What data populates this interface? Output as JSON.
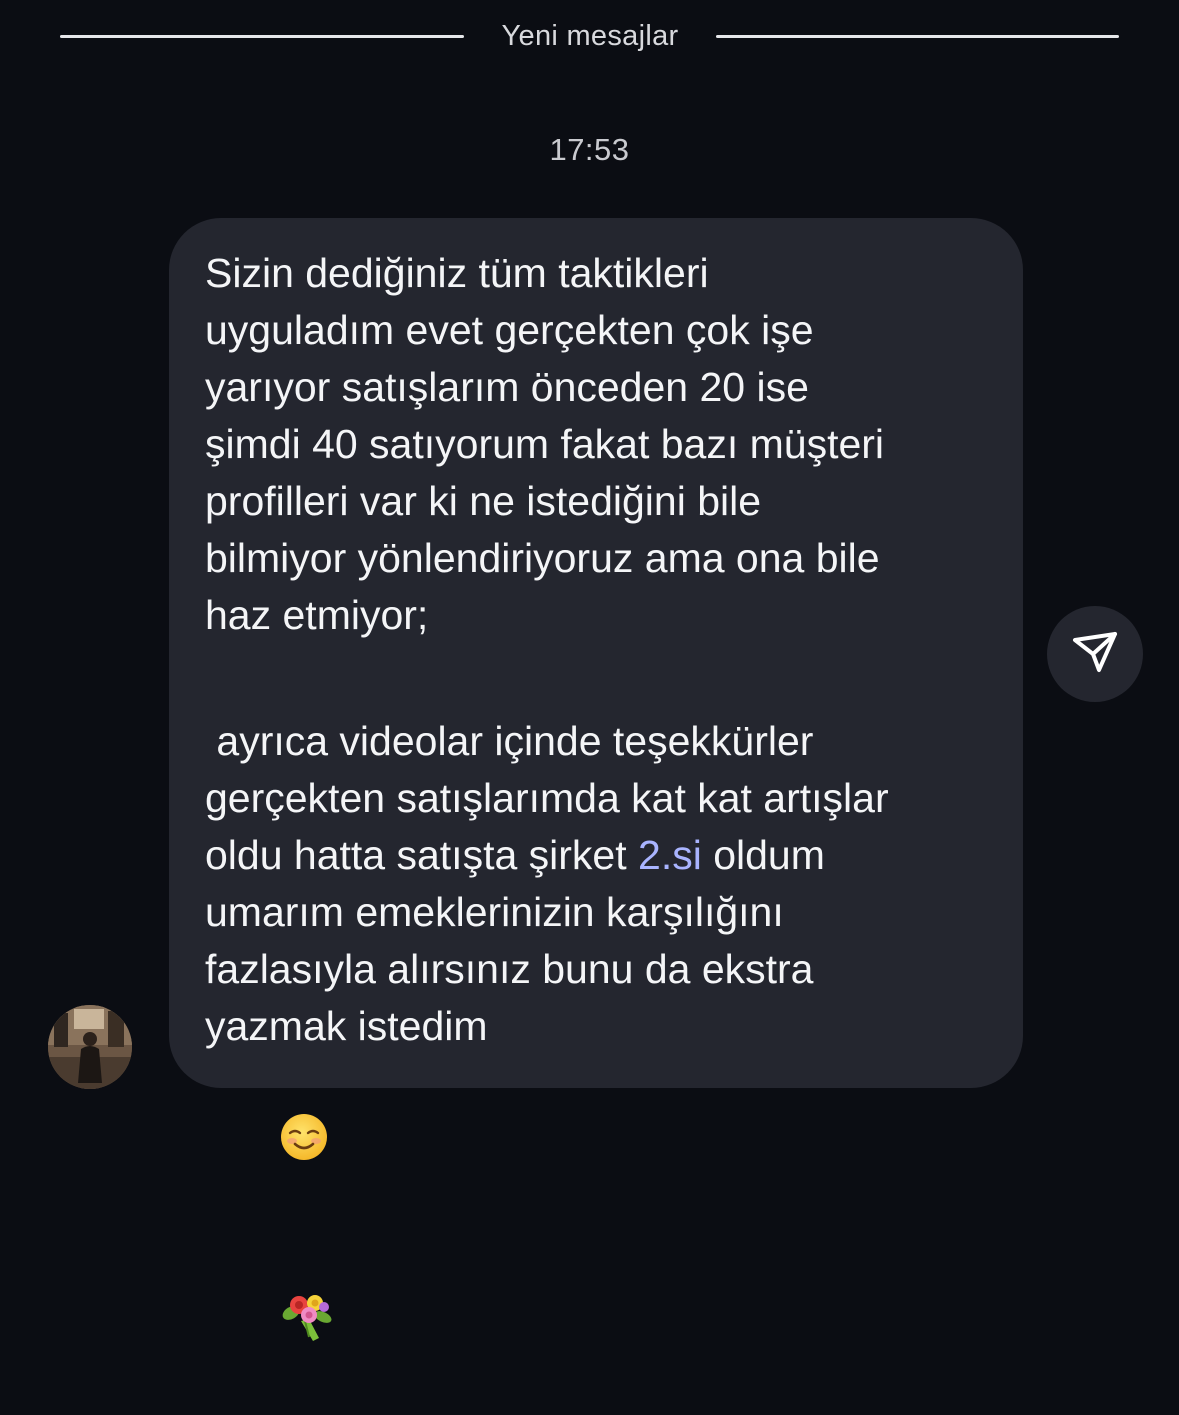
{
  "divider": {
    "label": "Yeni mesajlar"
  },
  "timestamp": "17:53",
  "message": {
    "paragraph1": [
      "Sizin dediğiniz tüm taktikleri",
      "uyguladım evet gerçekten çok işe",
      "yarıyor satışlarım önceden 20 ise",
      "şimdi 40 satıyorum fakat bazı müşteri",
      "profilleri var ki ne istediğini bile",
      "bilmiyor yönlendiriyoruz ama ona bile",
      "haz etmiyor;"
    ],
    "paragraph2": {
      "line1": " ayrıca videolar içinde teşekkürler",
      "line2": "gerçekten satışlarımda kat kat artışlar",
      "line3_before": "oldu hatta satışta şirket ",
      "line3_link": "2.si",
      "line3_after": " oldum",
      "line4": "umarım emeklerinizin karşılığını",
      "line5": "fazlasıyla alırsınız bunu da ekstra",
      "line6": "yazmak istedim"
    },
    "emojis": [
      "smiling-face-emoji",
      "bouquet-emoji"
    ]
  },
  "icons": {
    "share": "paper-plane-icon",
    "avatar": "user-avatar"
  },
  "colors": {
    "background": "#0b0d13",
    "bubble": "#24262f",
    "text": "#f4f5f7",
    "link": "#a9b4ff"
  }
}
